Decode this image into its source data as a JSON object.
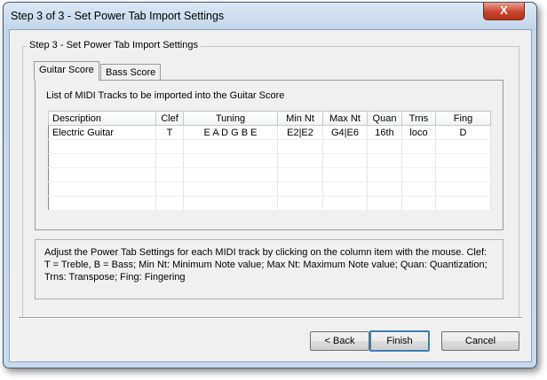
{
  "window": {
    "title": "Step 3 of 3 - Set Power Tab Import Settings",
    "close_label": "X"
  },
  "group": {
    "label": "Step 3 - Set Power Tab Import Settings"
  },
  "tabs": [
    {
      "label": "Guitar Score",
      "active": true
    },
    {
      "label": "Bass Score",
      "active": false
    }
  ],
  "panel": {
    "label": "List of MIDI Tracks to be imported into the Guitar Score"
  },
  "table": {
    "columns": [
      "Description",
      "Clef",
      "Tuning",
      "Min Nt",
      "Max Nt",
      "Quan",
      "Trns",
      "Fing"
    ],
    "rows": [
      [
        "Electric Guitar",
        "T",
        "E A D G B E",
        "E2|E2",
        "G4|E6",
        "16th",
        "loco",
        "D"
      ]
    ]
  },
  "info": "Adjust the Power Tab Settings for each MIDI track by clicking on the column item with the mouse.  Clef: T = Treble, B = Bass; Min Nt: Minimum Note value; Max Nt: Maximum Note value; Quan: Quantization; Trns: Transpose; Fing: Fingering",
  "buttons": {
    "back": "< Back",
    "finish": "Finish",
    "cancel": "Cancel"
  }
}
